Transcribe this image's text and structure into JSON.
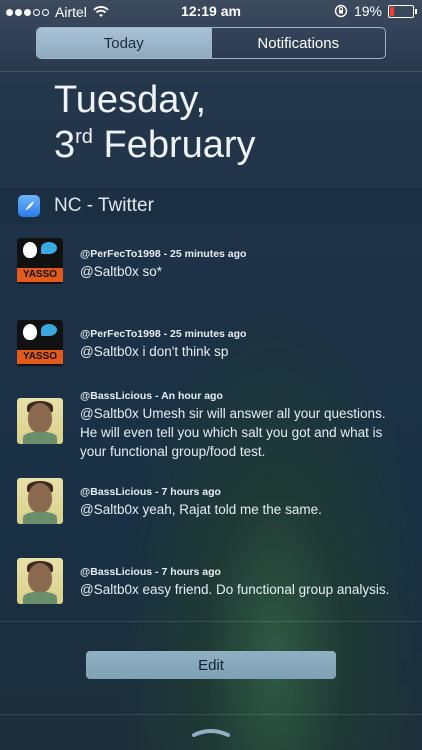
{
  "status_bar": {
    "carrier": "Airtel",
    "time": "12:19 am",
    "battery": "19%",
    "battery_level": 0.19,
    "signal_bars": 3,
    "signal_total": 5
  },
  "tabs": [
    {
      "label": "Today",
      "active": true
    },
    {
      "label": "Notifications",
      "active": false
    }
  ],
  "date": {
    "line1": "Tuesday,",
    "day": "3",
    "suffix": "rd",
    "month": "February"
  },
  "widget": {
    "title": "NC - Twitter",
    "icon": "feather-icon"
  },
  "tweets": [
    {
      "user": "@PerFecTo1998",
      "time": "25 minutes ago",
      "text": "@Saltb0x so*",
      "avatar": "yasso-avatar"
    },
    {
      "user": "@PerFecTo1998",
      "time": "25 minutes ago",
      "text": "@Saltb0x i don't think sp",
      "avatar": "yasso-avatar"
    },
    {
      "user": "@BassLicious",
      "time": "An hour ago",
      "text": "@Saltb0x Umesh sir will answer all your questions. He will even tell you which salt you got and what is your functional group/food test.",
      "avatar": "face-avatar"
    },
    {
      "user": "@BassLicious",
      "time": "7 hours ago",
      "text": "@Saltb0x yeah, Rajat told me the same.",
      "avatar": "face-avatar"
    },
    {
      "user": "@BassLicious",
      "time": "7 hours ago",
      "text": "@Saltb0x easy friend. Do functional group analysis.",
      "avatar": "face-avatar"
    }
  ],
  "tweet_separator": " - ",
  "edit_label": "Edit",
  "colors": {
    "battery_low": "#ff3b30",
    "segment_active": "#a9c2d5",
    "edit_button": "#8fb0c2"
  }
}
